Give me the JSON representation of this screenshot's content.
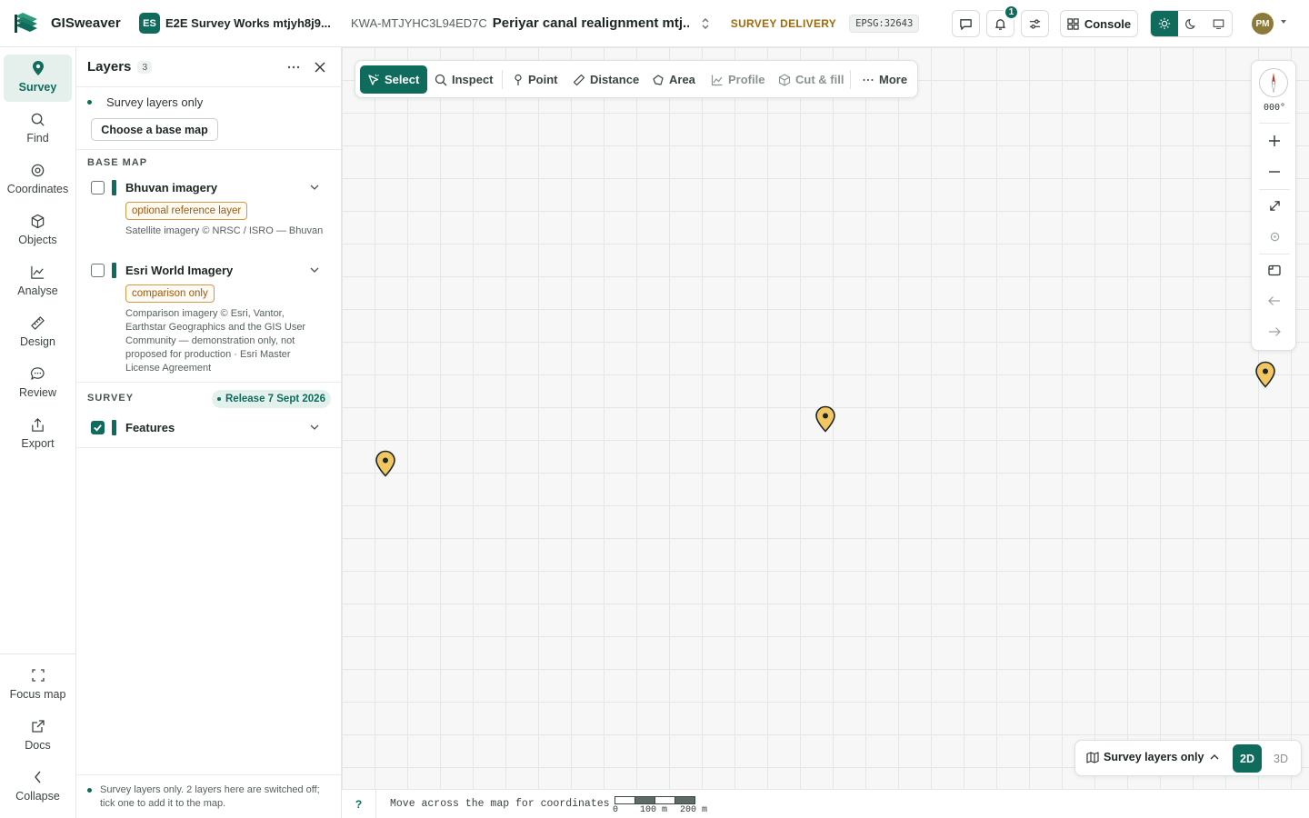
{
  "header": {
    "app_name": "GISweaver",
    "workspace_badge": "ES",
    "workspace_name": "E2E Survey Works mtjyh8j9...",
    "project_code": "KWA-MTJYHC3L94ED7C",
    "project_name": "Periyar canal realignment mtj...",
    "status": "SURVEY DELIVERY",
    "epsg": "EPSG:32643",
    "notification_count": "1",
    "console_label": "Console",
    "avatar_initials": "PM"
  },
  "rail": {
    "items": [
      {
        "label": "Survey",
        "icon": "map-pin-icon",
        "active": true
      },
      {
        "label": "Find",
        "icon": "search-icon"
      },
      {
        "label": "Coordinates",
        "icon": "crosshair-icon"
      },
      {
        "label": "Objects",
        "icon": "cube-icon"
      },
      {
        "label": "Analyse",
        "icon": "line-chart-icon"
      },
      {
        "label": "Design",
        "icon": "ruler-icon"
      },
      {
        "label": "Review",
        "icon": "comment-icon"
      },
      {
        "label": "Export",
        "icon": "share-icon"
      }
    ],
    "bottom_items": [
      {
        "label": "Focus map",
        "icon": "focus-icon"
      },
      {
        "label": "Docs",
        "icon": "external-link-icon"
      },
      {
        "label": "Collapse",
        "icon": "chevron-left-icon"
      }
    ]
  },
  "layers_panel": {
    "title": "Layers",
    "count": "3",
    "filter_label": "Survey layers only",
    "basemap_button": "Choose a base map",
    "base_map_heading": "BASE MAP",
    "base_layers": [
      {
        "name": "Bhuvan imagery",
        "tag": "optional reference layer",
        "description": "Satellite imagery © NRSC / ISRO — Bhuvan",
        "checked": false
      },
      {
        "name": "Esri World Imagery",
        "tag": "comparison only",
        "description": "Comparison imagery © Esri, Vantor, Earthstar Geographics and the GIS User Community — demonstration only, not proposed for production · Esri Master License Agreement",
        "checked": false
      }
    ],
    "survey_heading": "SURVEY",
    "release_label": "Release 7 Sept 2026",
    "survey_layers": [
      {
        "name": "Features",
        "checked": true
      }
    ],
    "footer_text": "Survey layers only. 2 layers here are switched off; tick one to add it to the map."
  },
  "toolbar": {
    "tools": [
      {
        "label": "Select",
        "icon": "cursor-icon",
        "active": true
      },
      {
        "label": "Inspect",
        "icon": "search-icon"
      },
      {
        "label": "Point",
        "icon": "pin-icon"
      },
      {
        "label": "Distance",
        "icon": "ruler-icon"
      },
      {
        "label": "Area",
        "icon": "polygon-icon"
      },
      {
        "label": "Profile",
        "icon": "chart-icon",
        "muted": true
      },
      {
        "label": "Cut & fill",
        "icon": "cube-icon",
        "muted": true
      },
      {
        "label": "More",
        "icon": "ellipsis-icon"
      }
    ]
  },
  "map_controls": {
    "heading": "000°"
  },
  "view_switch": {
    "layers_label": "Survey layers only",
    "mode_2d": "2D",
    "mode_3d": "3D",
    "active_mode": "2D"
  },
  "statusbar": {
    "help": "?",
    "coords_hint": "Move across the map for coordinates",
    "scale_labels": [
      "0",
      "100 m",
      "200 m"
    ]
  },
  "colors": {
    "accent": "#0f6b5c",
    "status_amber": "#a06a0a",
    "pin_fill": "#f2c661"
  }
}
